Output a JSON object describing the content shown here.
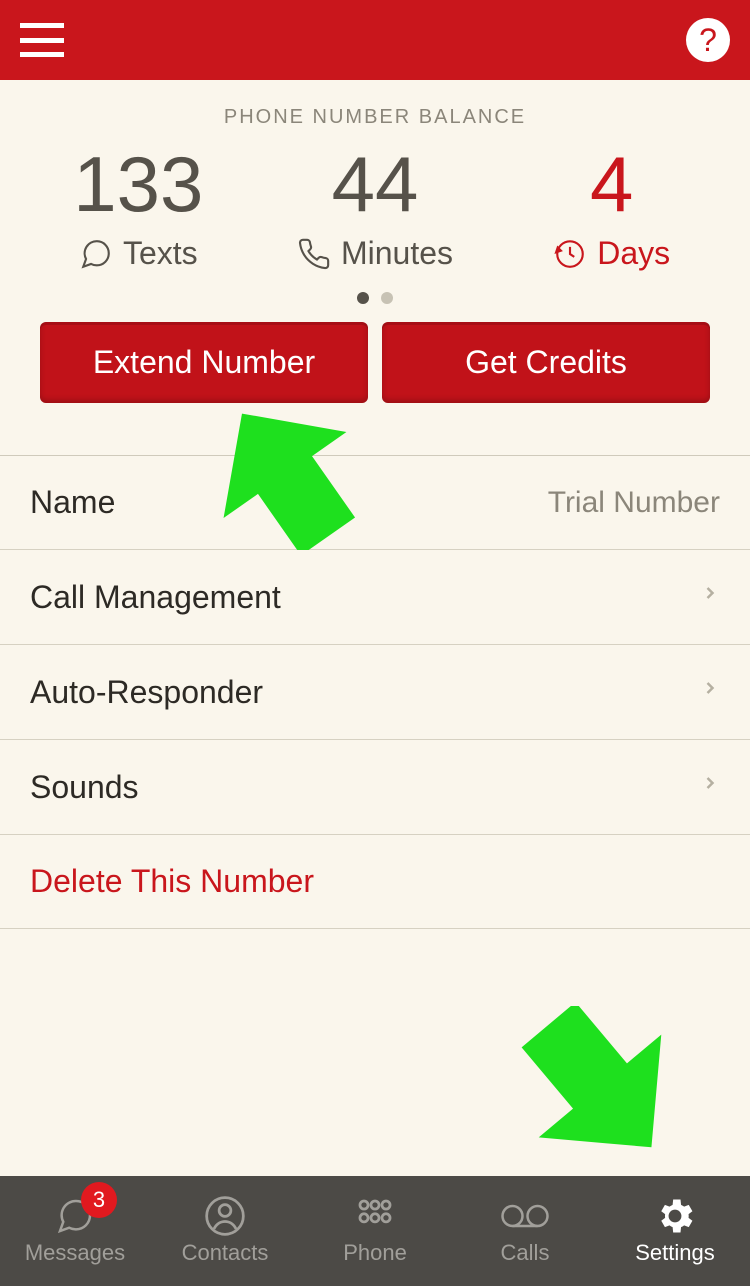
{
  "header": {
    "help_label": "?"
  },
  "balance": {
    "title": "PHONE NUMBER BALANCE",
    "stats": [
      {
        "value": "133",
        "label": "Texts"
      },
      {
        "value": "44",
        "label": "Minutes"
      },
      {
        "value": "4",
        "label": "Days"
      }
    ]
  },
  "buttons": {
    "extend": "Extend Number",
    "credits": "Get Credits"
  },
  "rows": {
    "name_label": "Name",
    "name_value": "Trial Number",
    "call_mgmt": "Call Management",
    "auto_responder": "Auto-Responder",
    "sounds": "Sounds",
    "delete": "Delete This Number"
  },
  "tabs": {
    "messages": "Messages",
    "contacts": "Contacts",
    "phone": "Phone",
    "calls": "Calls",
    "settings": "Settings",
    "badge": "3"
  }
}
